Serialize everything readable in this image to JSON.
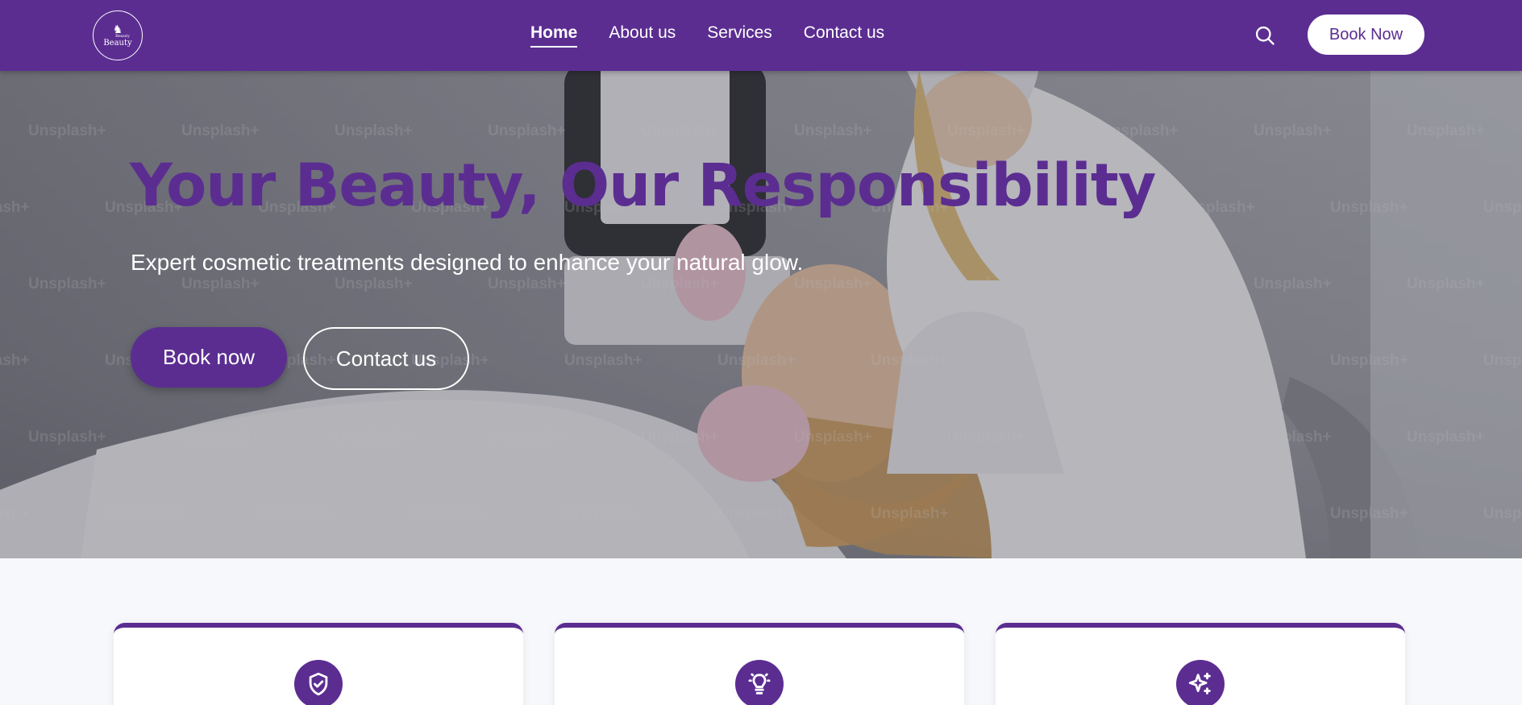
{
  "brand": {
    "logo_text": "Beauty",
    "logo_small": "Beauty",
    "accent_color": "#5b2d91"
  },
  "nav": {
    "links": [
      {
        "label": "Home",
        "active": true
      },
      {
        "label": "About us",
        "active": false
      },
      {
        "label": "Services",
        "active": false
      },
      {
        "label": "Contact us",
        "active": false
      }
    ],
    "search_icon": "search-icon",
    "book_button": "Book Now"
  },
  "hero": {
    "title": "Your Beauty, Our Responsibility",
    "subtitle": "Expert cosmetic treatments designed to enhance your natural glow.",
    "primary_button": "Book now",
    "secondary_button": "Contact us",
    "watermark": "Unsplash+"
  },
  "features": {
    "cards": [
      {
        "icon": "shield-check-icon"
      },
      {
        "icon": "lightbulb-icon"
      },
      {
        "icon": "sparkles-icon"
      }
    ]
  }
}
